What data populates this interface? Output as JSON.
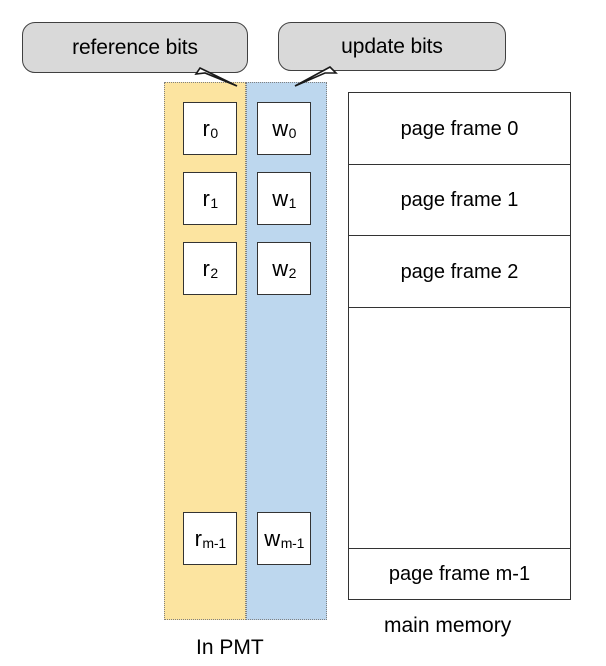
{
  "callouts": {
    "reference": {
      "label": "reference bits"
    },
    "update": {
      "label": "update bits"
    }
  },
  "pmt": {
    "caption": "In PMT",
    "reference_column": {
      "name": "reference bits column",
      "color": "#fce4a0",
      "cells": [
        {
          "base": "r",
          "sub": "0"
        },
        {
          "base": "r",
          "sub": "1"
        },
        {
          "base": "r",
          "sub": "2"
        },
        {
          "base": "r",
          "sub": "m-1"
        }
      ]
    },
    "update_column": {
      "name": "update bits column",
      "color": "#bdd7ee",
      "cells": [
        {
          "base": "w",
          "sub": "0"
        },
        {
          "base": "w",
          "sub": "1"
        },
        {
          "base": "w",
          "sub": "2"
        },
        {
          "base": "w",
          "sub": "m-1"
        }
      ]
    }
  },
  "memory": {
    "caption": "main memory",
    "rows": [
      {
        "label": "page frame 0"
      },
      {
        "label": "page frame 1"
      },
      {
        "label": "page frame 2"
      },
      {
        "label": ""
      },
      {
        "label": "page frame m-1"
      }
    ]
  },
  "colors": {
    "reference_fill": "#fce4a0",
    "update_fill": "#bdd7ee",
    "callout_fill": "#d9d9d9",
    "outline": "#333333",
    "dotted_border": "#808080"
  }
}
